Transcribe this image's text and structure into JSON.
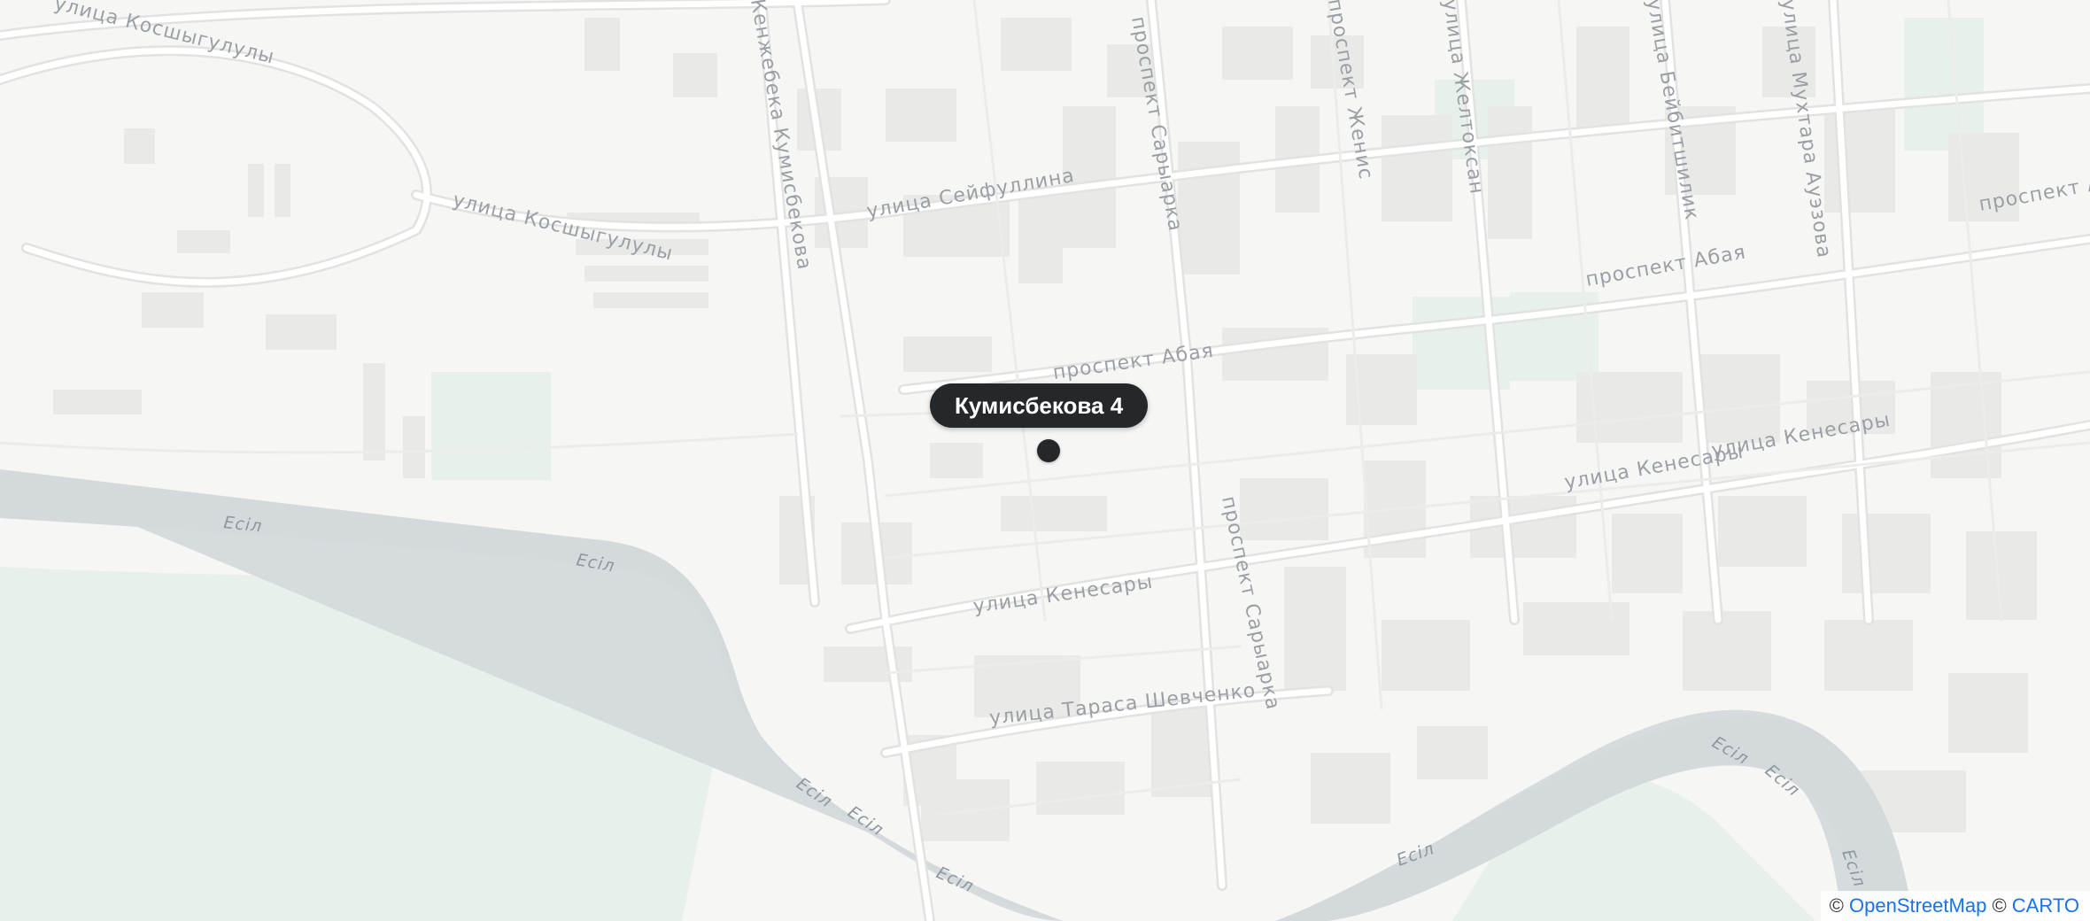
{
  "map": {
    "colors": {
      "background": "#f6f6f4",
      "building": "#e9e9e7",
      "road": "#ffffff",
      "road_casing": "#e2e2e0",
      "water": "#d5dadd",
      "park": "#e6efe9",
      "label": "#9aa0a6",
      "marker": "#25282b"
    },
    "marker": {
      "label": "Кумисбекова 4",
      "icon": "location-dot-icon"
    },
    "street_labels": [
      "улица Косшыгулулы",
      "улица Косшыгулулы",
      "Кенжебека Кумисбекова",
      "проспект Сарыарка",
      "проспект Женис",
      "улица Желтоксан",
      "улица Бейбитшилик",
      "улица Мухтара Ауэзова",
      "улица  Сейфуллина",
      "проспект Абая",
      "проспект Абая",
      "проспект Абая",
      "улица Кенесары",
      "улица Кенесары",
      "улица Кенесары",
      "проспект Сарыарка",
      "улица Тараса Шевченко"
    ],
    "river_labels": [
      "Есіл",
      "Есіл",
      "Есіл",
      "Есіл",
      "Есіл",
      "Есіл",
      "Есіл",
      "Есіл",
      "Есіл"
    ],
    "attribution": {
      "prefix": "©",
      "osm": "OpenStreetMap",
      "middle": "©",
      "carto": "CARTO"
    }
  }
}
